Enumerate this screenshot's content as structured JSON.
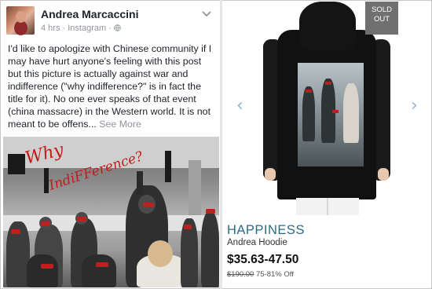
{
  "post": {
    "author": "Andrea Marcaccini",
    "meta": "4 hrs · Instagram · ",
    "privacy_icon": "globe-icon",
    "body": "I'd like to apologize with Chinese community if I may have hurt anyone's feeling with this post but this picture is actually against war and indifference (\"why indifference?\" is in fact the title for it). No one ever speaks of that event (china massacre) in the Western world. It is not meant to be offens...",
    "see_more": "See More",
    "graffiti_line1": "Why",
    "graffiti_line2": "IndiFFerence?"
  },
  "product": {
    "badge_line1": "SOLD",
    "badge_line2": "OUT",
    "prev_arrow": "‹",
    "next_arrow": "›",
    "brand": "HAPPINESS",
    "name": "Andrea Hoodie",
    "price": "$35.63-47.50",
    "original_price": "$190.00",
    "discount": "75-81% Off"
  },
  "colors": {
    "brand_blue": "#2a6a86",
    "badge_gray": "#707070",
    "graffiti_red": "#c41a1a"
  }
}
